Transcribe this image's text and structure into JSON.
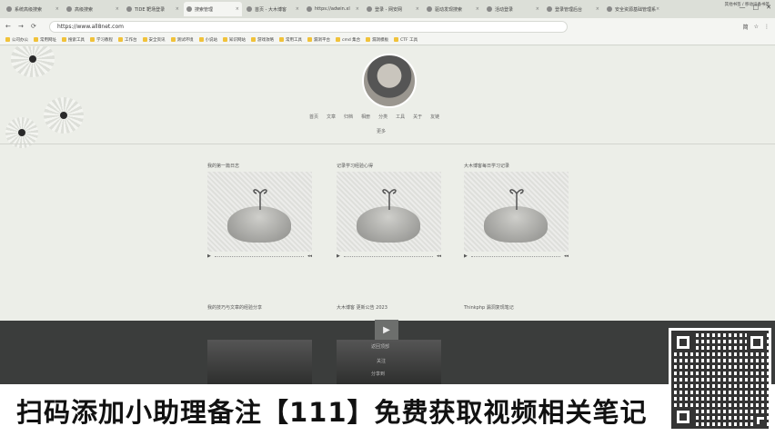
{
  "browser": {
    "tabs": [
      {
        "label": "系统高级搜索"
      },
      {
        "label": "高级搜索"
      },
      {
        "label": "TIDE 靶场登录"
      },
      {
        "label": "搜索管理",
        "active": true
      },
      {
        "label": "首页 - 大木博客"
      },
      {
        "label": "https://adwin.xl"
      },
      {
        "label": "登录 - 网安网"
      },
      {
        "label": "驱动发现搜索"
      },
      {
        "label": "活动登录"
      },
      {
        "label": "登录管理后台"
      },
      {
        "label": "安全资源基础管理系"
      }
    ],
    "window_controls": [
      "—",
      "□",
      "✕"
    ],
    "url": "https://www.all8net.com",
    "addr_right": [
      "简",
      "☆",
      "⋮"
    ],
    "bookmarks": [
      "公司办公",
      "常用网址",
      "搜索工具",
      "学习教程",
      "工作台",
      "安全资讯",
      "测试环境",
      "小说站",
      "知识网站",
      "游戏攻略",
      "常用工具",
      "漏洞平台",
      "cmd 集合",
      "漏洞模板",
      "CTF 工具"
    ],
    "bookmarks_right": "其他书签 / 移动设备书签"
  },
  "profile": {
    "nav": [
      "首页",
      "文章",
      "归档",
      "相册",
      "分类",
      "工具",
      "关于",
      "友链"
    ],
    "sub_link": "更多"
  },
  "cards": [
    {
      "title": "我的第一篇日志",
      "caption": "我的技巧与文章的经验分享"
    },
    {
      "title": "记录学习经验心得",
      "caption": "大木博客 更新公告 2023"
    },
    {
      "title": "大木博客每日学习记录",
      "caption": "Thinkphp 漏洞复现笔记"
    }
  ],
  "video": {
    "play_icon": "▶",
    "menu": [
      "返回顶部",
      "关注",
      "分享到"
    ]
  },
  "banner": {
    "text": "扫码添加小助理备注【111】免费获取视频相关笔记"
  }
}
